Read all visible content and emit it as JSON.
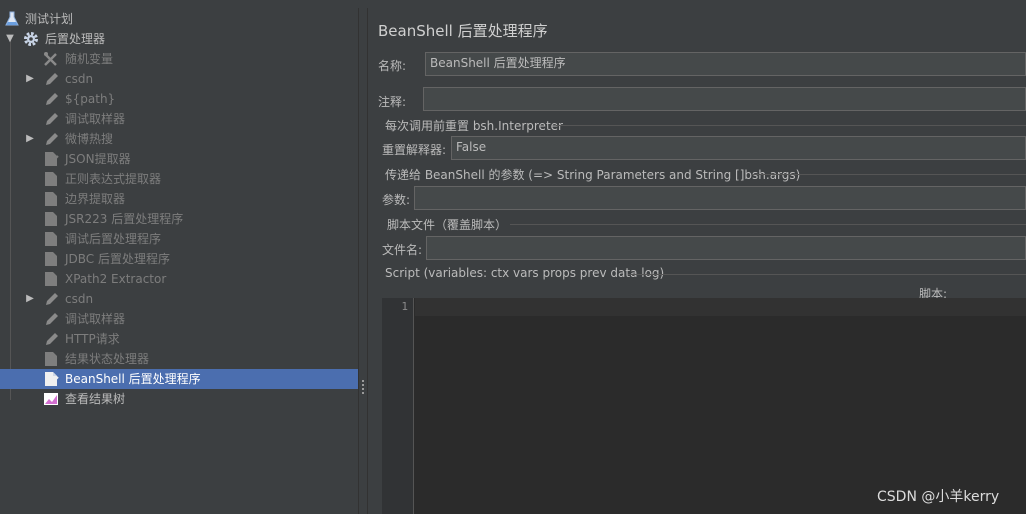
{
  "tree": {
    "items": [
      {
        "label": "测试计划",
        "icon": "test-plan-icon",
        "state": "enabled"
      },
      {
        "label": "后置处理器",
        "icon": "gear-icon",
        "state": "enabled",
        "expanded": true
      },
      {
        "label": "随机变量",
        "icon": "config-element-icon",
        "state": "disabled"
      },
      {
        "label": "csdn",
        "icon": "sampler-pencil-icon",
        "state": "disabled",
        "collapsed": true
      },
      {
        "label": "${path}",
        "icon": "sampler-pencil-icon",
        "state": "disabled"
      },
      {
        "label": "调试取样器",
        "icon": "sampler-pencil-icon",
        "state": "disabled"
      },
      {
        "label": "微博热搜",
        "icon": "sampler-pencil-icon",
        "state": "disabled",
        "collapsed": true
      },
      {
        "label": "JSON提取器",
        "icon": "post-processor-doc-icon",
        "state": "disabled"
      },
      {
        "label": "正则表达式提取器",
        "icon": "post-processor-doc-icon",
        "state": "disabled"
      },
      {
        "label": "边界提取器",
        "icon": "post-processor-doc-icon",
        "state": "disabled"
      },
      {
        "label": "JSR223 后置处理程序",
        "icon": "post-processor-doc-icon",
        "state": "disabled"
      },
      {
        "label": "调试后置处理程序",
        "icon": "post-processor-doc-icon",
        "state": "disabled"
      },
      {
        "label": "JDBC 后置处理程序",
        "icon": "post-processor-doc-icon",
        "state": "disabled"
      },
      {
        "label": "XPath2 Extractor",
        "icon": "post-processor-doc-icon",
        "state": "disabled"
      },
      {
        "label": "csdn",
        "icon": "sampler-pencil-icon",
        "state": "disabled",
        "collapsed": true
      },
      {
        "label": "调试取样器",
        "icon": "sampler-pencil-icon",
        "state": "disabled"
      },
      {
        "label": "HTTP请求",
        "icon": "sampler-pencil-icon",
        "state": "disabled"
      },
      {
        "label": "结果状态处理器",
        "icon": "post-processor-doc-icon",
        "state": "disabled"
      },
      {
        "label": "BeanShell 后置处理程序",
        "icon": "post-processor-doc-icon",
        "state": "selected"
      },
      {
        "label": "查看结果树",
        "icon": "listener-chart-icon",
        "state": "enabled"
      }
    ]
  },
  "panel": {
    "title": "BeanShell 后置处理程序",
    "name_label": "名称:",
    "name_value": "BeanShell 后置处理程序",
    "comment_label": "注释:",
    "comment_value": "",
    "reset_group": "每次调用前重置 bsh.Interpreter",
    "reset_label": "重置解释器:",
    "reset_value": "False",
    "params_group": "传递给 BeanShell 的参数 (=> String Parameters and String []bsh.args)",
    "params_label": "参数:",
    "params_value": "",
    "file_group": "脚本文件（覆盖脚本）",
    "file_label": "文件名:",
    "file_value": "",
    "script_group": "Script (variables: ctx vars props prev data log)",
    "script_label": "脚本:",
    "line_number": "1"
  },
  "watermark": "CSDN @小羊kerry",
  "colors": {
    "background": "#3c3f41",
    "selection": "#4b6eaf",
    "field": "#45494a",
    "editor": "#2b2b2b",
    "disabled_text": "#7d7d7d"
  }
}
